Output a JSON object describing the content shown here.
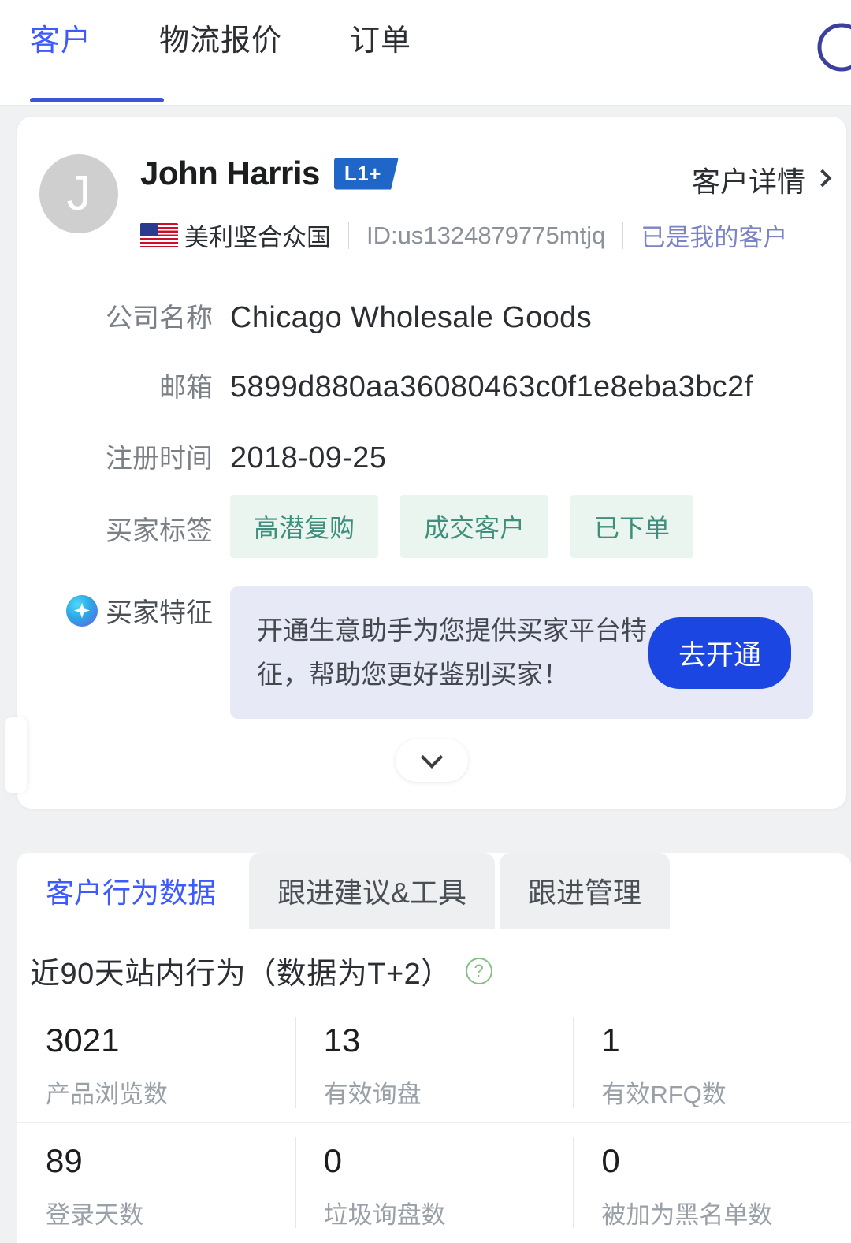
{
  "nav": {
    "tabs": [
      {
        "label": "客户",
        "active": true
      },
      {
        "label": "物流报价",
        "active": false
      },
      {
        "label": "订单",
        "active": false
      }
    ],
    "search_icon": "search-icon"
  },
  "profile": {
    "avatar_initial": "J",
    "name": "John Harris",
    "level_badge": "L1+",
    "detail_link": "客户详情",
    "country": "美利坚合众国",
    "country_flag": "us-flag-icon",
    "id": "ID:us1324879775mtjq",
    "relation": "已是我的客户",
    "rows": [
      {
        "label": "公司名称",
        "value": "Chicago Wholesale Goods"
      },
      {
        "label": "邮箱",
        "value": "5899d880aa36080463c0f1e8eba3bc2f"
      },
      {
        "label": "注册时间",
        "value": "2018-09-25"
      }
    ],
    "tags_label": "买家标签",
    "tags": [
      "高潜复购",
      "成交客户",
      "已下单"
    ],
    "feature_label": "买家特征",
    "feature_icon": "sparkle-icon",
    "promo_text": "开通生意助手为您提供买家平台特征，帮助您更好鉴别买家！",
    "promo_button": "去开通",
    "collapse_icon": "chevron-down-icon"
  },
  "data_card": {
    "tabs": [
      {
        "label": "客户行为数据",
        "active": true
      },
      {
        "label": "跟进建议&工具",
        "active": false
      },
      {
        "label": "跟进管理",
        "active": false
      }
    ],
    "section_title": "近90天站内行为（数据为T+2）",
    "help_icon": "help-circle-icon",
    "stats": [
      [
        {
          "value": "3021",
          "label": "产品浏览数"
        },
        {
          "value": "13",
          "label": "有效询盘"
        },
        {
          "value": "1",
          "label": "有效RFQ数"
        }
      ],
      [
        {
          "value": "89",
          "label": "登录天数"
        },
        {
          "value": "0",
          "label": "垃圾询盘数"
        },
        {
          "value": "0",
          "label": "被加为黑名单数"
        }
      ]
    ]
  },
  "colors": {
    "accent_blue": "#3d5afe",
    "badge_blue": "#2066c9",
    "button_blue": "#1b46e2",
    "tag_green": "#3f8f7c",
    "tag_bg": "#eaf5f0",
    "page_bg": "#f0f1f3"
  }
}
